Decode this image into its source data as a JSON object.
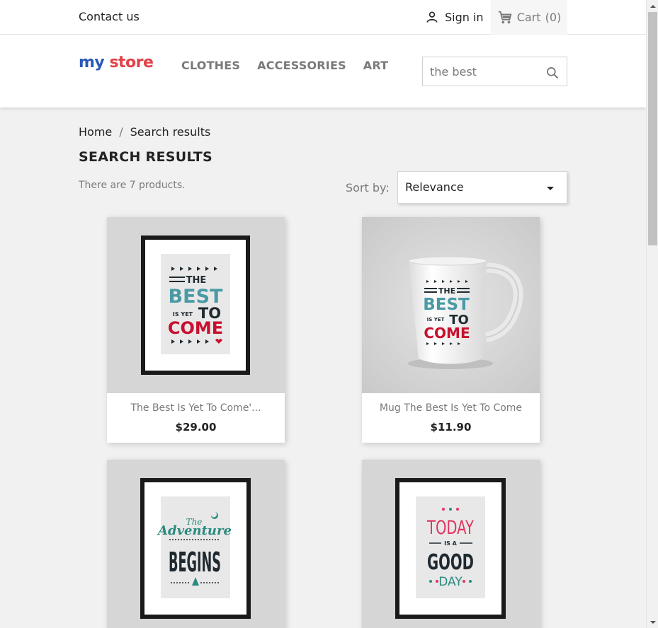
{
  "topbar": {
    "contact_label": "Contact us",
    "signin_label": "Sign in",
    "cart_label": "Cart",
    "cart_count": "(0)"
  },
  "header": {
    "logo_my": "my",
    "logo_store": "store",
    "nav": [
      "CLOTHES",
      "ACCESSORIES",
      "ART"
    ],
    "search_value": "the best"
  },
  "breadcrumb": {
    "home": "Home",
    "separator": "/",
    "current": "Search results"
  },
  "main": {
    "title": "SEARCH RESULTS",
    "count_text": "There are 7 products.",
    "sort_label": "Sort by:",
    "sort_value": "Relevance"
  },
  "products": [
    {
      "name": "The Best Is Yet To Come'...",
      "price": "$29.00",
      "art": {
        "line1": "THE",
        "line2": "BEST",
        "line3a": "IS YET",
        "line3b": "TO",
        "line4": "COME"
      }
    },
    {
      "name": "Mug The Best Is Yet To Come",
      "price": "$11.90",
      "art": {
        "line1": "THE",
        "line2": "BEST",
        "line3a": "IS YET",
        "line3b": "TO",
        "line4": "COME"
      }
    },
    {
      "art": {
        "line1": "The",
        "line2": "Adventure",
        "line3": "BEGINS"
      }
    },
    {
      "art": {
        "line1": "TODAY",
        "line2": "IS A",
        "line3": "GOOD",
        "line4": "DAY"
      }
    }
  ],
  "colors": {
    "teal": "#4a9aa5",
    "red": "#c8102e",
    "dark": "#1f2a30",
    "pink": "#e0355f",
    "logo_blue": "#2a58b8",
    "logo_red": "#e0424a"
  }
}
